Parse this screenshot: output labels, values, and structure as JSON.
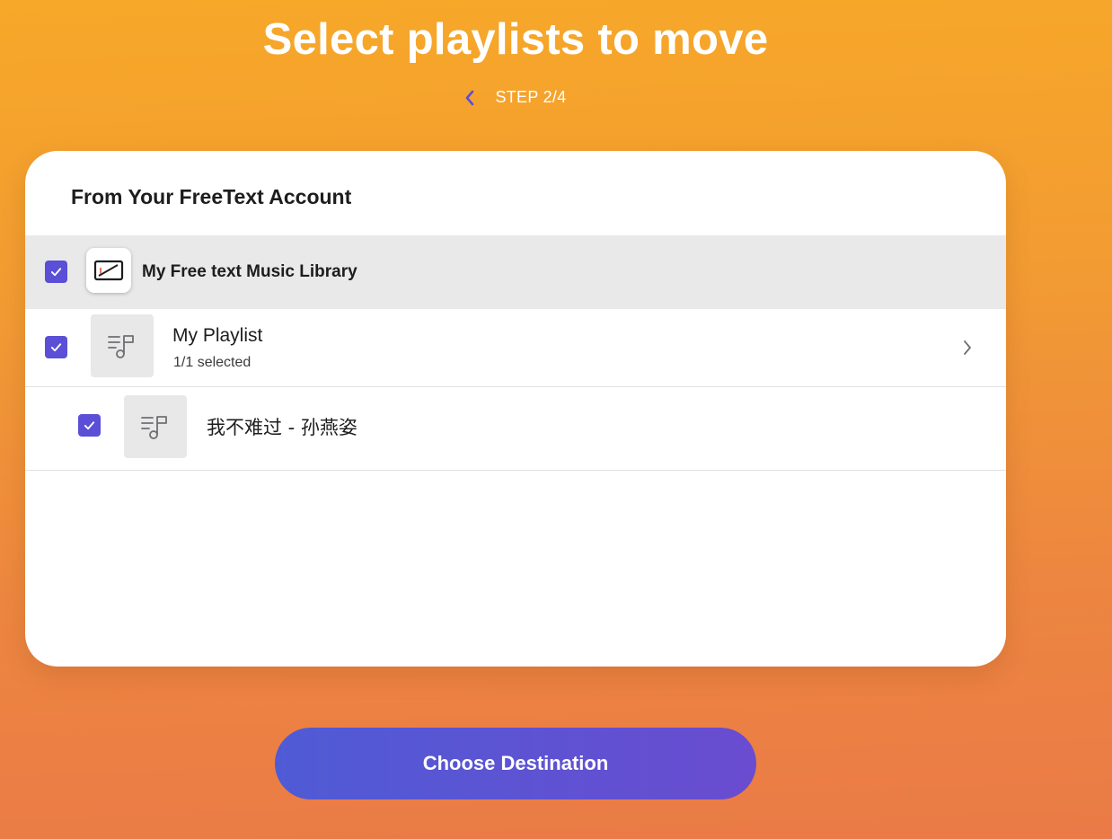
{
  "header": {
    "title": "Select playlists to move",
    "step_label": "STEP 2/4"
  },
  "source_card": {
    "title": "From Your FreeText Account",
    "library": {
      "label": "My Free text Music Library",
      "checked": true
    },
    "playlists": [
      {
        "name": "My Playlist",
        "subtitle": "1/1 selected",
        "checked": true,
        "tracks": [
          {
            "title": "我不难过 - 孙燕姿",
            "checked": true
          }
        ]
      }
    ]
  },
  "actions": {
    "primary_label": "Choose Destination"
  },
  "icons": {
    "back": "chevron-left-icon",
    "expand": "chevron-right-icon",
    "checkbox": "checkmark-icon",
    "thumb": "music-note-icon",
    "app": "freetext-app-icon"
  },
  "colors": {
    "background_top": "#f7a828",
    "background_bottom": "#ea7a47",
    "accent": "#5a4fd6",
    "button_start": "#4f5bd5",
    "button_end": "#6a4cd0"
  }
}
